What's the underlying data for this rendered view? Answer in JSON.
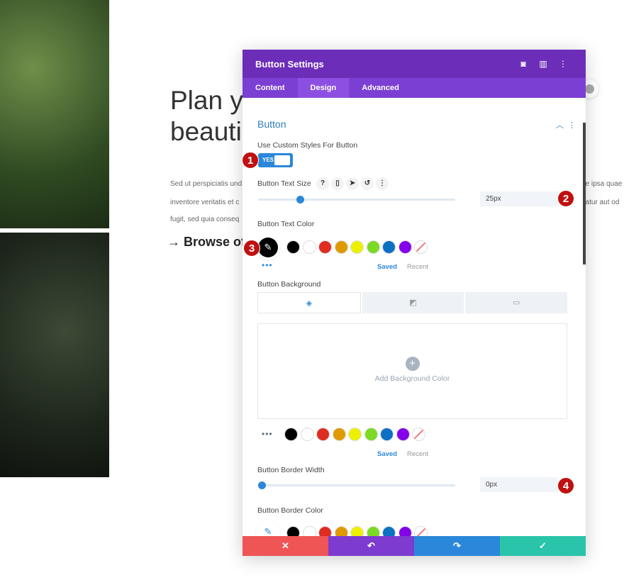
{
  "page": {
    "heading": "Plan y\nbeauti",
    "para": [
      "Sed ut perspiciatis und",
      "inventore veritatis et c",
      "fugit, sed quia conseq"
    ],
    "para_right": [
      "ue ipsa quae",
      "natur aut od"
    ],
    "browse": "→ Browse of"
  },
  "panel": {
    "title": "Button Settings",
    "header_icons": [
      "focus-icon",
      "sidebar-icon",
      "more-icon"
    ],
    "tabs": [
      "Content",
      "Design",
      "Advanced"
    ],
    "active_tab": "Design",
    "section": "Button",
    "custom_styles_label": "Use Custom Styles For Button",
    "toggle": "YES",
    "text_size_label": "Button Text Size",
    "text_size_value": "25px",
    "text_size_percent": 20,
    "text_color_label": "Button Text Color",
    "swatches": [
      "#000000",
      "#ffffff",
      "#e02b20",
      "#e09900",
      "#edf000",
      "#7cda24",
      "#0c71c3",
      "#8300e9"
    ],
    "saved": "Saved",
    "recent": "Recent",
    "bg_label": "Button Background",
    "add_bg": "Add Background Color",
    "border_width_label": "Button Border Width",
    "border_width_value": "0px",
    "border_width_percent": 0,
    "border_color_label": "Button Border Color",
    "footer_colors": [
      "#ef5555",
      "#7d3bcf",
      "#2b87da",
      "#29c4a9"
    ]
  },
  "badges": [
    "1",
    "2",
    "3",
    "4"
  ]
}
